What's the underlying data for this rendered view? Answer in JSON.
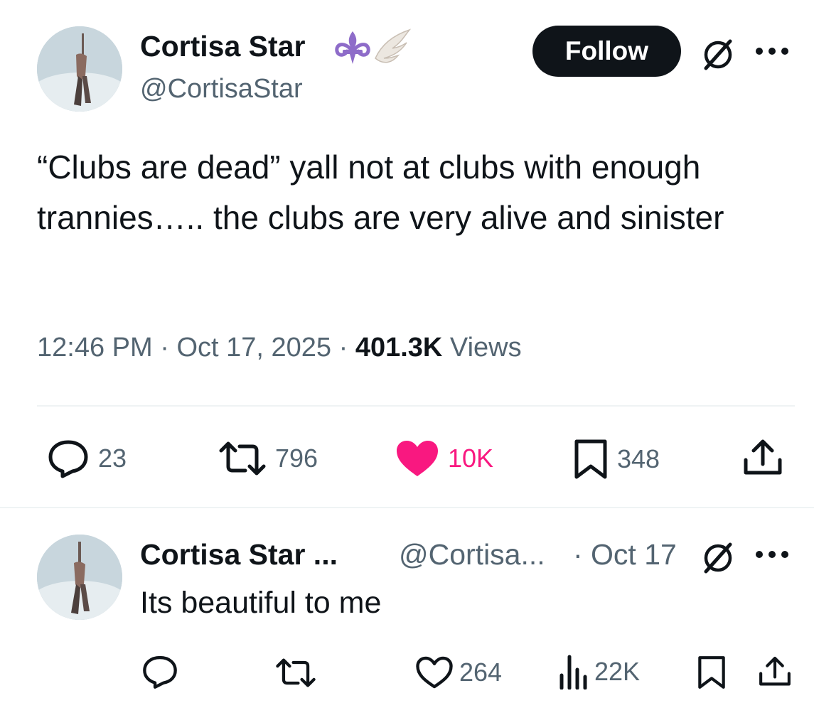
{
  "tweet": {
    "author_name": "Cortisa Star",
    "author_handle": "@CortisaStar",
    "follow_label": "Follow",
    "text": "“Clubs are dead” yall not at clubs with enough trannies….. the clubs are very alive and sinister",
    "time": "12:46 PM",
    "separator": "·",
    "date": "Oct 17, 2025",
    "views_count": "401.3K",
    "views_label": "Views",
    "stats": {
      "replies": "23",
      "reposts": "796",
      "likes": "10K",
      "bookmarks": "348"
    }
  },
  "reply": {
    "author_name": "Cortisa Star ...",
    "author_handle": "@Cortisa...",
    "date": "· Oct 17",
    "text": "Its beautiful to me",
    "stats": {
      "likes": "264",
      "views": "22K"
    }
  },
  "colors": {
    "text_primary": "#0f1419",
    "text_secondary": "#536471",
    "like_pink": "#f91880",
    "divider": "#eff3f4",
    "badge_purple": "#8e6cc9"
  },
  "icons": {
    "badge_1": "fleur-de-lis-icon",
    "badge_2": "angel-wing-icon",
    "grok": "grok-icon",
    "more": "more-icon",
    "reply": "reply-icon",
    "repost": "repost-icon",
    "like": "heart-icon",
    "bookmark": "bookmark-icon",
    "share": "share-icon",
    "views": "views-chart-icon"
  }
}
